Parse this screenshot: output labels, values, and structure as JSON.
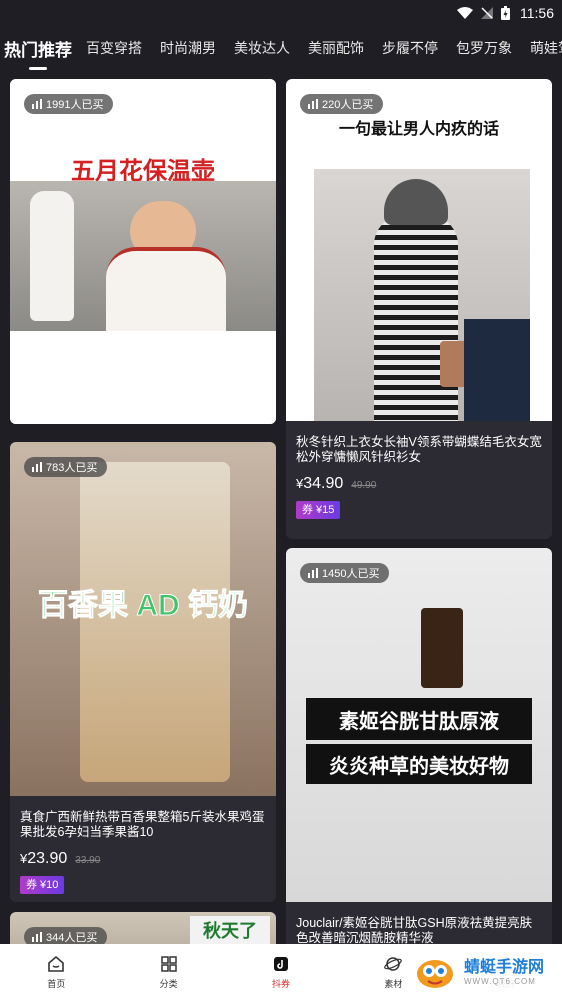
{
  "status": {
    "time": "11:56"
  },
  "tabs": [
    "热门推荐",
    "百变穿搭",
    "时尚潮男",
    "美妆达人",
    "美丽配饰",
    "步履不停",
    "包罗万象",
    "萌娃驾"
  ],
  "cards": [
    {
      "badge": "1991人已买",
      "image_text": "五月花保温壶"
    },
    {
      "badge": "220人已买",
      "image_text": "一句最让男人内疚的话",
      "title": "秋冬针织上衣女长袖V领系带蝴蝶结毛衣女宽松外穿慵懒风针织衫女",
      "price": "34.90",
      "orig": "49.90",
      "coupon": "券 ¥15"
    },
    {
      "badge": "783人已买",
      "image_text": "百香果 AD 钙奶",
      "title": "真食广西新鲜热带百香果整箱5斤装水果鸡蛋果批发6孕妇当季果酱10",
      "price": "23.90",
      "orig": "33.90",
      "coupon": "券 ¥10"
    },
    {
      "badge": "1450人已买",
      "image_text_1": "素姬谷胱甘肽原液",
      "image_text_2": "炎炎种草的美妆好物",
      "title": "Jouclair/素姬谷胱甘肽GSH原液祛黄提亮肤色改善暗沉烟酰胺精华液"
    },
    {
      "badge": "344人已买",
      "image_text": "秋天了"
    }
  ],
  "nav": [
    {
      "label": "首页",
      "icon": "home-icon"
    },
    {
      "label": "分类",
      "icon": "grid-icon"
    },
    {
      "label": "抖券",
      "icon": "douyin-icon"
    },
    {
      "label": "素材",
      "icon": "planet-icon"
    },
    {
      "label": "我的",
      "icon": "user-icon"
    }
  ],
  "watermark": {
    "text": "蜻蜓手游网",
    "sub": "WWW.QT6.COM"
  },
  "colors": {
    "background": "#1f1e25",
    "card": "#2c2b33",
    "nav_active": "#d82a2a",
    "coupon_start": "#b13ac9",
    "coupon_end": "#6a3be2"
  }
}
